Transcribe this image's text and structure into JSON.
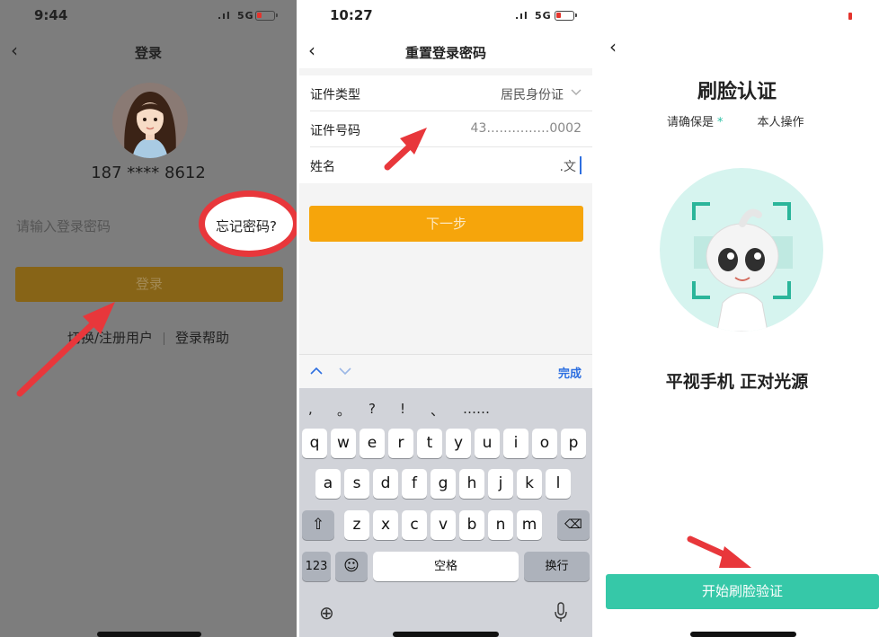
{
  "login_screen": {
    "status": {
      "time": "9:44",
      "network": "5G"
    },
    "nav": {
      "title": "登录"
    },
    "phone_masked": "187 **** 8612",
    "password_placeholder": "请输入登录密码",
    "forgot_password": "忘记密码?",
    "login_button": "登录",
    "switch_register": "切换/注册用户",
    "login_help": "登录帮助"
  },
  "reset_screen": {
    "status": {
      "time": "10:27",
      "network": "5G"
    },
    "nav": {
      "title": "重置登录密码"
    },
    "fields": [
      {
        "label": "证件类型",
        "value": "居民身份证"
      },
      {
        "label": "证件号码",
        "value": "43……………0002"
      },
      {
        "label": "姓名",
        "value": ".文"
      }
    ],
    "next_button": "下一步",
    "keyboard": {
      "done": "完成",
      "punctuation": [
        ",",
        "。",
        "?",
        "!",
        "、",
        "……"
      ],
      "row1": [
        "q",
        "w",
        "e",
        "r",
        "t",
        "y",
        "u",
        "i",
        "o",
        "p"
      ],
      "row2": [
        "a",
        "s",
        "d",
        "f",
        "g",
        "h",
        "j",
        "k",
        "l"
      ],
      "row3": [
        "z",
        "x",
        "c",
        "v",
        "b",
        "n",
        "m"
      ],
      "numbers_key": "123",
      "space_key": "空格",
      "return_key": "换行"
    }
  },
  "face_screen": {
    "title": "刷脸认证",
    "subtitle_prefix": "请确保是",
    "subtitle_masked": "*",
    "subtitle_suffix": "本人操作",
    "hint": "平视手机 正对光源",
    "start_button": "开始刷脸验证"
  },
  "colors": {
    "annotation_red": "#e8373b",
    "login_button_dim": "#876417",
    "next_button": "#f6a50b",
    "face_accent": "#2bb59a",
    "start_button": "#36c8a8"
  }
}
